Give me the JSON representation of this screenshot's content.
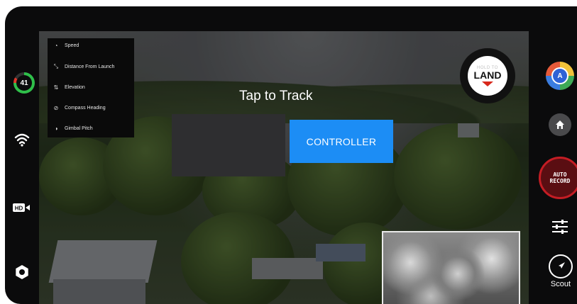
{
  "telemetry": {
    "items": [
      {
        "label": "Speed",
        "icon": "speed-icon",
        "glyph": "◔"
      },
      {
        "label": "Distance From Launch",
        "icon": "distance-icon",
        "glyph": "⤡"
      },
      {
        "label": "Elevation",
        "icon": "elevation-icon",
        "glyph": "⇅"
      },
      {
        "label": "Compass Heading",
        "icon": "compass-icon",
        "glyph": "⊘"
      },
      {
        "label": "Gimbal Pitch",
        "icon": "gimbal-icon",
        "glyph": "◑"
      }
    ]
  },
  "main": {
    "tap_to_track": "Tap to Track",
    "controller_label": "CONTROLLER"
  },
  "land": {
    "hold_to": "HOLD TO",
    "land": "LAND"
  },
  "left_bar": {
    "battery": "41",
    "battery_color": "#2fbf4a",
    "hd_label": "HD"
  },
  "right_bar": {
    "nav_letter": "A",
    "auto_record": "AUTO\nRECORD",
    "auto_record_line1": "AUTO",
    "auto_record_line2": "RECORD",
    "scout_label": "Scout"
  },
  "colors": {
    "accent_blue": "#1c8df5",
    "record_red": "#c41d24",
    "land_red": "#d8281b"
  }
}
